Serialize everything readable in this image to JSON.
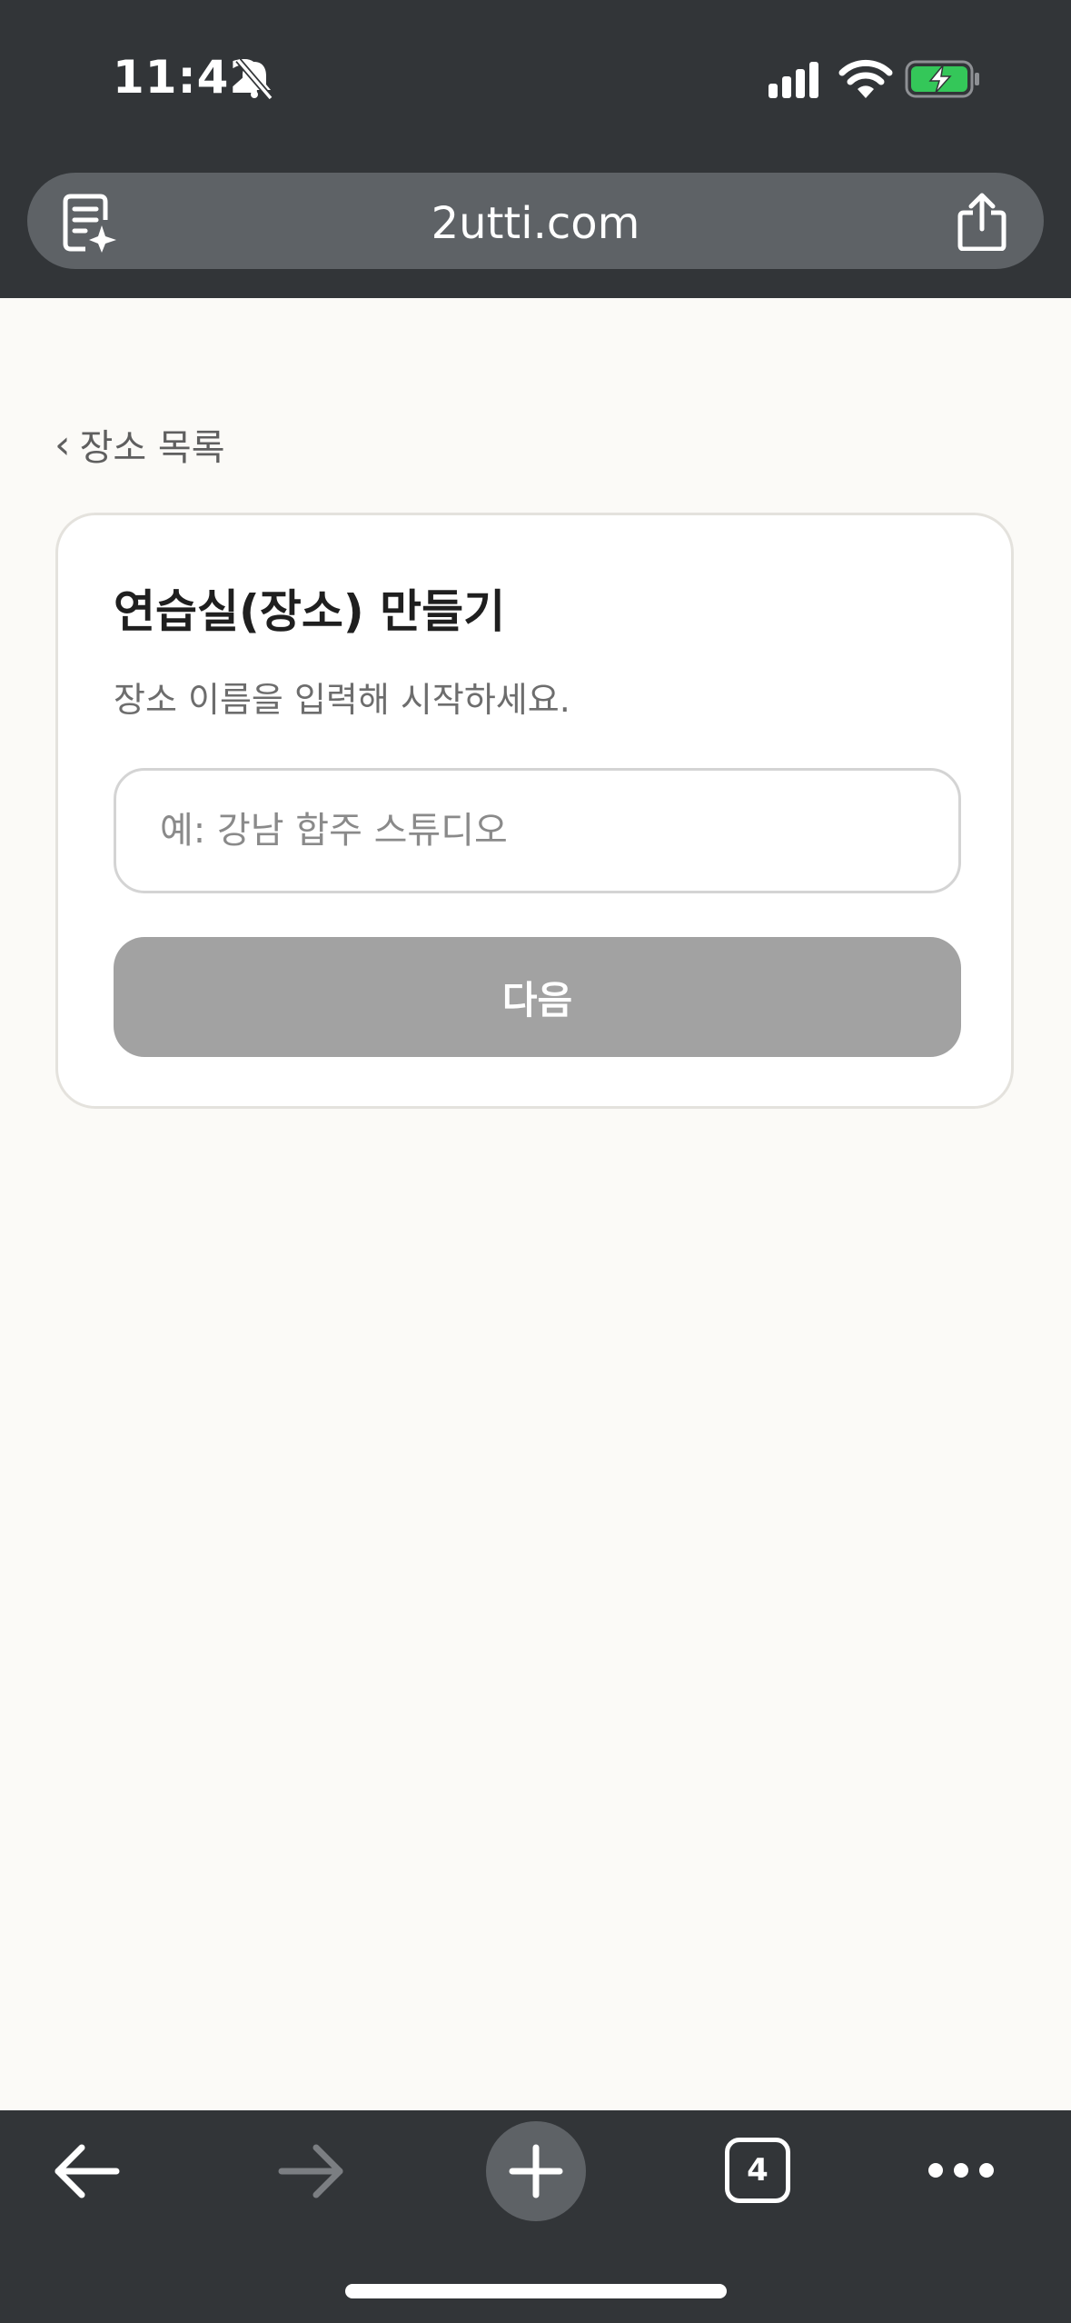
{
  "status_bar": {
    "time": "11:42",
    "icons": [
      "bell-slash-icon",
      "cellular-signal-icon",
      "wifi-icon",
      "battery-charging-icon"
    ],
    "battery_color": "#34c759"
  },
  "browser": {
    "url": "2utti.com",
    "tab_count": "4"
  },
  "page": {
    "back_link": "장소 목록",
    "back_chevron": "‹",
    "card": {
      "title": "연습실(장소) 만들기",
      "subtitle": "장소 이름을 입력해 시작하세요.",
      "name_input": {
        "value": "",
        "placeholder": "예: 강남 합주 스튜디오"
      },
      "next_label": "다음",
      "next_disabled_color": "#a2a2a2"
    }
  }
}
